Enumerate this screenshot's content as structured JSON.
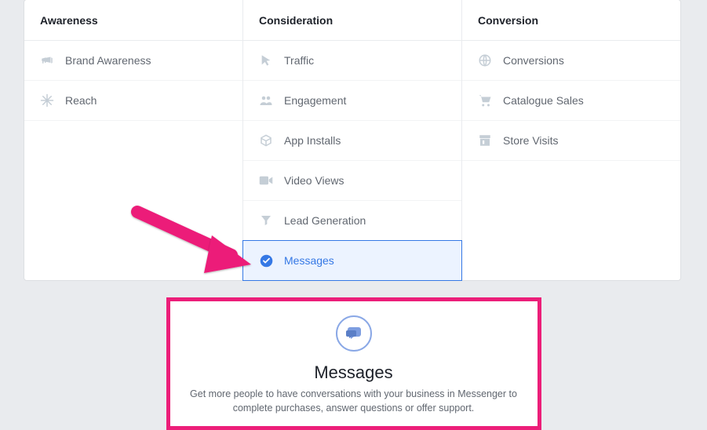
{
  "columns": {
    "awareness": {
      "header": "Awareness",
      "items": [
        {
          "label": "Brand Awareness",
          "icon": "megaphone-icon"
        },
        {
          "label": "Reach",
          "icon": "snowflake-icon"
        }
      ]
    },
    "consideration": {
      "header": "Consideration",
      "items": [
        {
          "label": "Traffic",
          "icon": "cursor-icon"
        },
        {
          "label": "Engagement",
          "icon": "people-icon"
        },
        {
          "label": "App Installs",
          "icon": "cube-icon"
        },
        {
          "label": "Video Views",
          "icon": "video-icon"
        },
        {
          "label": "Lead Generation",
          "icon": "funnel-icon"
        },
        {
          "label": "Messages",
          "icon": "check-icon",
          "selected": true
        }
      ]
    },
    "conversion": {
      "header": "Conversion",
      "items": [
        {
          "label": "Conversions",
          "icon": "globe-icon"
        },
        {
          "label": "Catalogue Sales",
          "icon": "cart-icon"
        },
        {
          "label": "Store Visits",
          "icon": "store-icon"
        }
      ]
    }
  },
  "detail": {
    "title": "Messages",
    "description": "Get more people to have conversations with your business in Messenger to complete purchases, answer questions or offer support."
  }
}
